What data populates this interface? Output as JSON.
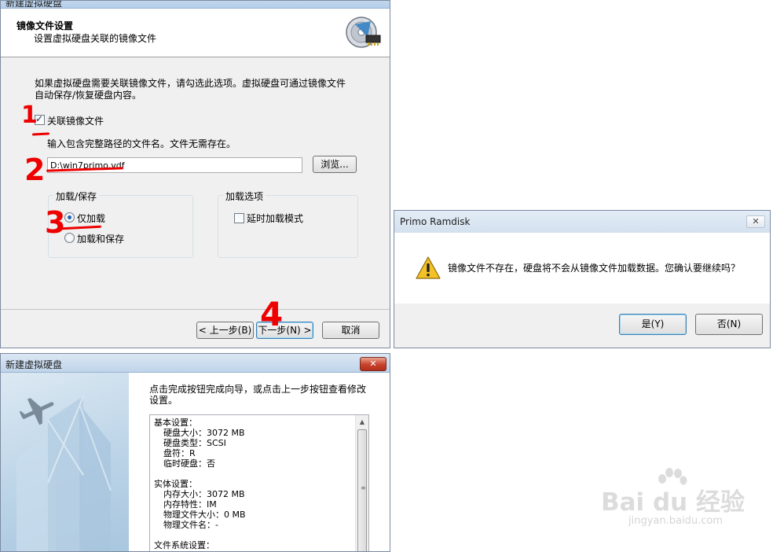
{
  "window1": {
    "title": "新建虚拟硬盘",
    "header_title": "镜像文件设置",
    "header_subtitle": "设置虚拟硬盘关联的镜像文件",
    "description_line1": "如果虚拟硬盘需要关联镜像文件，请勾选此选项。虚拟硬盘可通过镜像文件",
    "description_line2": "自动保存/恢复硬盘内容。",
    "associate_checkbox_label": "关联镜像文件",
    "associate_checked": true,
    "path_hint": "输入包含完整路径的文件名。文件无需存在。",
    "path_value": "D:\\win7primo.vdf",
    "browse_label": "浏览...",
    "load_save_group": "加载/保存",
    "radio_load_only": "仅加载",
    "radio_load_and_save": "加载和保存",
    "selected_option": "仅加载",
    "load_options_group": "加载选项",
    "delayed_load_label": "延时加载模式",
    "delayed_load_checked": false,
    "back_label": "< 上一步(B)",
    "next_label": "下一步(N) >",
    "cancel_label": "取消",
    "close_glyph": "✕",
    "annotations": [
      "1",
      "2",
      "3",
      "4"
    ],
    "annotation_color": "#e00000"
  },
  "window2": {
    "title": "Primo Ramdisk",
    "message": "镜像文件不存在，硬盘将不会从镜像文件加载数据。您确认要继续吗？",
    "yes_label": "是(Y)",
    "no_label": "否(N)",
    "close_glyph": "✕",
    "icon": "warning-icon"
  },
  "window3": {
    "title": "新建虚拟硬盘",
    "intro_line1": "点击完成按钮完成向导，或点击上一步按钮查看修改",
    "intro_line2": "设置。",
    "close_glyph": "✕",
    "summary": {
      "basic_header": "基本设置：",
      "disk_size": "硬盘大小：3072 MB",
      "disk_type": "硬盘类型：SCSI",
      "drive_letter": "盘符：R",
      "temp_disk": "临时硬盘：否",
      "physical_header": "实体设置：",
      "memory_size": "内存大小：3072 MB",
      "memory_type": "内存特性：IM",
      "physical_file_size": "物理文件大小：0 MB",
      "physical_file_name": "物理文件名：-",
      "fs_header": "文件系统设置："
    }
  },
  "watermark": {
    "main": "Bai du 经验",
    "sub": "jingyan.baidu.com"
  }
}
